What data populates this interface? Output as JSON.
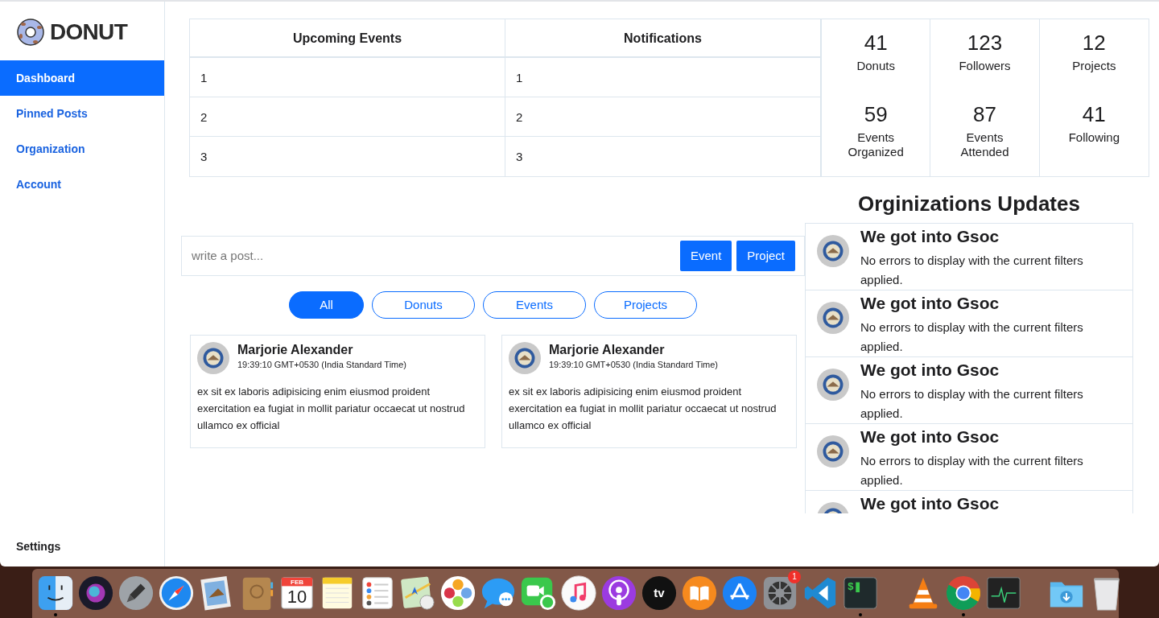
{
  "logo": {
    "text": "DONUT"
  },
  "sidebar": {
    "items": [
      {
        "label": "Dashboard",
        "selected": true
      },
      {
        "label": "Pinned Posts",
        "selected": false
      },
      {
        "label": "Organization",
        "selected": false
      },
      {
        "label": "Account",
        "selected": false
      }
    ],
    "footer": "Settings"
  },
  "tables": [
    {
      "header": "Upcoming Events",
      "rows": [
        "1",
        "2",
        "3"
      ]
    },
    {
      "header": "Notifications",
      "rows": [
        "1",
        "2",
        "3"
      ]
    }
  ],
  "stats": [
    {
      "value": "41",
      "label": "Donuts"
    },
    {
      "value": "123",
      "label": "Followers"
    },
    {
      "value": "12",
      "label": "Projects"
    },
    {
      "value": "59",
      "label": "Events Organized"
    },
    {
      "value": "87",
      "label": "Events Attended"
    },
    {
      "value": "41",
      "label": "Following"
    }
  ],
  "composer": {
    "placeholder": "write a post...",
    "buttons": [
      "Event",
      "Project"
    ]
  },
  "filters": [
    {
      "label": "All",
      "selected": true
    },
    {
      "label": "Donuts",
      "selected": false
    },
    {
      "label": "Events",
      "selected": false
    },
    {
      "label": "Projects",
      "selected": false
    }
  ],
  "posts": [
    {
      "author": "Marjorie Alexander",
      "time": "19:39:10 GMT+0530 (India Standard Time)",
      "body": "ex sit ex laboris adipisicing enim eiusmod proident exercitation ea fugiat in mollit pariatur occaecat ut nostrud ullamco ex official"
    },
    {
      "author": "Marjorie Alexander",
      "time": "19:39:10 GMT+0530 (India Standard Time)",
      "body": "ex sit ex laboris adipisicing enim eiusmod proident exercitation ea fugiat in mollit pariatur occaecat ut nostrud ullamco ex official"
    }
  ],
  "updates": {
    "title": "Orginizations Updates",
    "items": [
      {
        "title": "We got into Gsoc",
        "body": "No errors to display with the current filters applied."
      },
      {
        "title": "We got into Gsoc",
        "body": "No errors to display with the current filters applied."
      },
      {
        "title": "We got into Gsoc",
        "body": "No errors to display with the current filters applied."
      },
      {
        "title": "We got into Gsoc",
        "body": "No errors to display with the current filters applied."
      },
      {
        "title": "We got into Gsoc"
      }
    ]
  },
  "dock": [
    {
      "kind": "finder",
      "running": true
    },
    {
      "kind": "siri",
      "running": false
    },
    {
      "kind": "launchpad",
      "running": false
    },
    {
      "kind": "safari",
      "running": false
    },
    {
      "kind": "mail",
      "running": false
    },
    {
      "kind": "contacts",
      "running": false
    },
    {
      "kind": "calendar",
      "running": false,
      "month": "FEB",
      "day": "10"
    },
    {
      "kind": "notes",
      "running": false
    },
    {
      "kind": "reminders",
      "running": false
    },
    {
      "kind": "maps",
      "running": false
    },
    {
      "kind": "photos",
      "running": false
    },
    {
      "kind": "messages",
      "running": false
    },
    {
      "kind": "facetime",
      "running": false
    },
    {
      "kind": "music",
      "running": false
    },
    {
      "kind": "podcasts",
      "running": false
    },
    {
      "kind": "tv",
      "running": false,
      "label": "tv"
    },
    {
      "kind": "books",
      "running": false
    },
    {
      "kind": "appstore",
      "running": false
    },
    {
      "kind": "preferences",
      "running": false,
      "badge": "1"
    },
    {
      "kind": "vscode",
      "running": false
    },
    {
      "kind": "terminal",
      "running": true,
      "label": "$"
    },
    {
      "kind": "separator"
    },
    {
      "kind": "vlc",
      "running": false
    },
    {
      "kind": "chrome",
      "running": true
    },
    {
      "kind": "activity",
      "running": false
    },
    {
      "kind": "separator"
    },
    {
      "kind": "downloads",
      "running": false
    },
    {
      "kind": "trash",
      "running": false
    }
  ]
}
